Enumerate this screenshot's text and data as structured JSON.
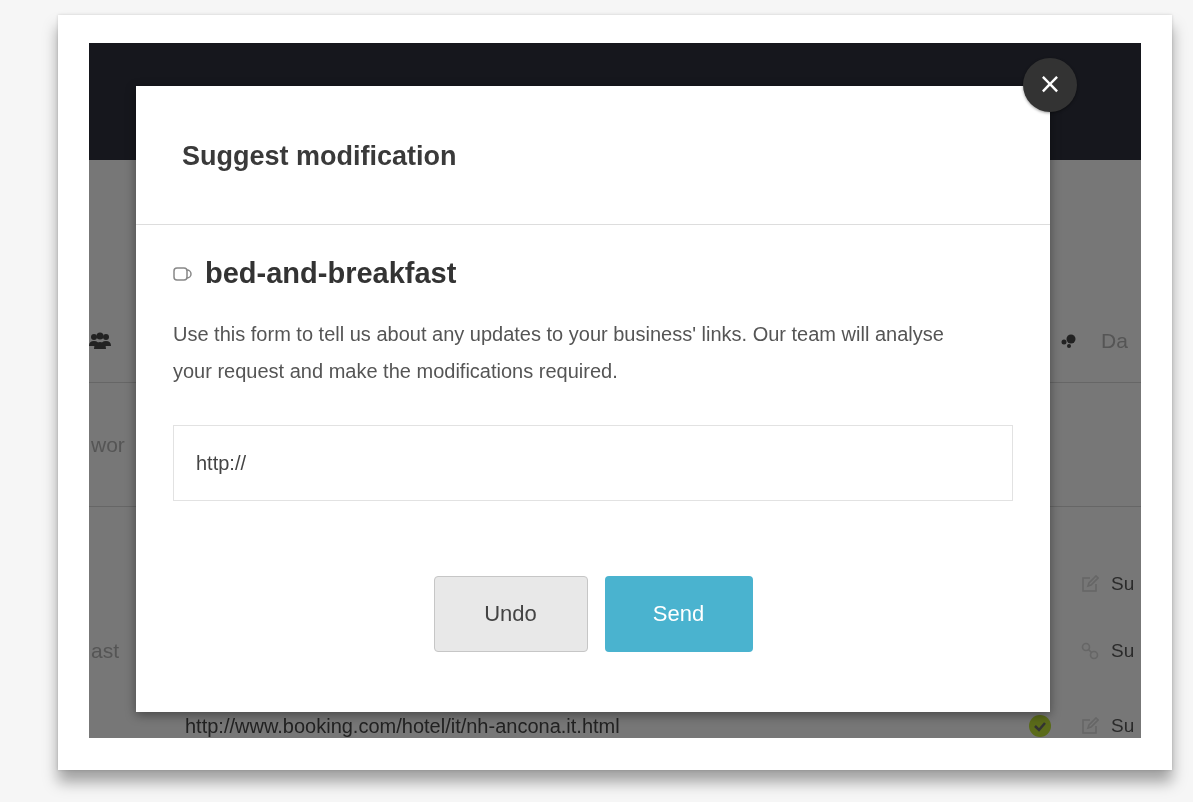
{
  "background": {
    "header_label": "Da",
    "rows": [
      {
        "left": "wor"
      },
      {
        "left": "ast"
      }
    ],
    "actions": [
      {
        "kind": "edit",
        "label": "Su"
      },
      {
        "kind": "link",
        "label": "Su"
      },
      {
        "kind": "edit",
        "label": "Su"
      }
    ],
    "link": {
      "url": "http://www.booking.com/hotel/it/nh-ancona.it.html",
      "verified": true
    }
  },
  "modal": {
    "title": "Suggest modification",
    "close": "×",
    "category": "bed-and-breakfast",
    "description": "Use this form to tell us about any updates to your business' links. Our team will analyse your request and make the modifications required.",
    "url_field": {
      "value": "http://"
    },
    "buttons": [
      {
        "label": "Undo",
        "kind": "secondary"
      },
      {
        "label": "Send",
        "kind": "primary"
      }
    ]
  }
}
